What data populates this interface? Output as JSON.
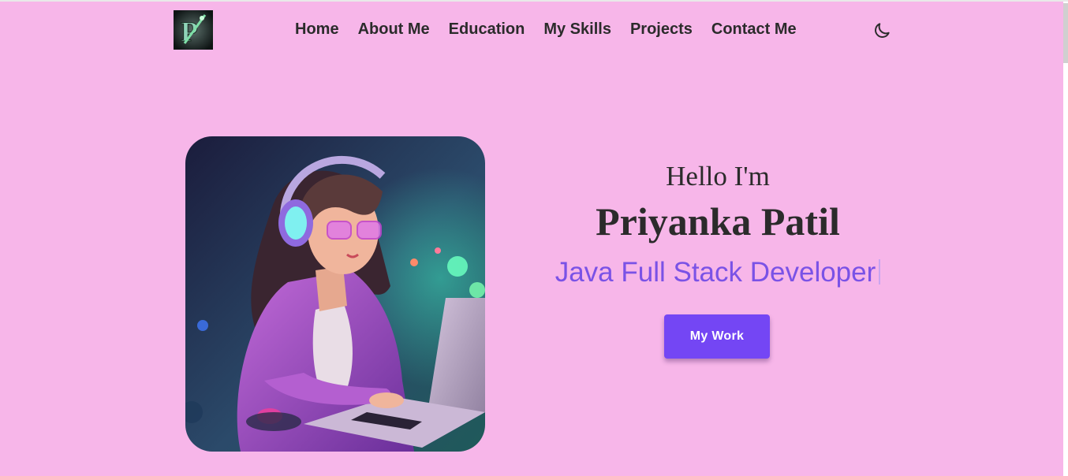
{
  "nav": {
    "logo_letter": "P",
    "items": [
      {
        "label": "Home"
      },
      {
        "label": "About Me"
      },
      {
        "label": "Education"
      },
      {
        "label": "My Skills"
      },
      {
        "label": "Projects"
      },
      {
        "label": "Contact Me"
      }
    ],
    "theme_toggle_icon": "moon-icon"
  },
  "hero": {
    "greeting": "Hello I'm",
    "name": "Priyanka Patil",
    "role": "Java Full Stack Developer",
    "button_label": "My Work",
    "image_icon": "developer-illustration"
  },
  "colors": {
    "background": "#f7b6e9",
    "text": "#2b2b2b",
    "accent": "#7a52e6",
    "button": "#7446f4"
  }
}
